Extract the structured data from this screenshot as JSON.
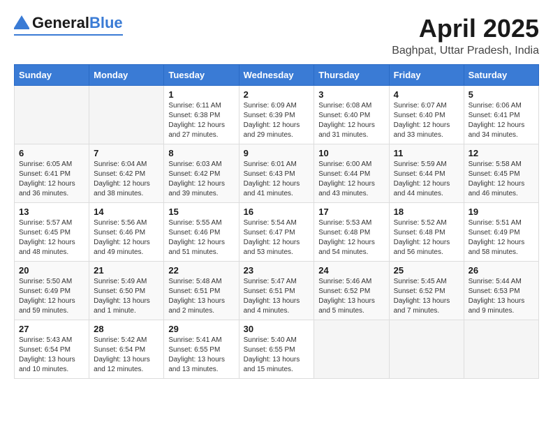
{
  "header": {
    "logo_general": "General",
    "logo_blue": "Blue",
    "month": "April 2025",
    "location": "Baghpat, Uttar Pradesh, India"
  },
  "days_of_week": [
    "Sunday",
    "Monday",
    "Tuesday",
    "Wednesday",
    "Thursday",
    "Friday",
    "Saturday"
  ],
  "weeks": [
    [
      {
        "day": "",
        "sunrise": "",
        "sunset": "",
        "daylight": ""
      },
      {
        "day": "",
        "sunrise": "",
        "sunset": "",
        "daylight": ""
      },
      {
        "day": "1",
        "sunrise": "Sunrise: 6:11 AM",
        "sunset": "Sunset: 6:38 PM",
        "daylight": "Daylight: 12 hours and 27 minutes."
      },
      {
        "day": "2",
        "sunrise": "Sunrise: 6:09 AM",
        "sunset": "Sunset: 6:39 PM",
        "daylight": "Daylight: 12 hours and 29 minutes."
      },
      {
        "day": "3",
        "sunrise": "Sunrise: 6:08 AM",
        "sunset": "Sunset: 6:40 PM",
        "daylight": "Daylight: 12 hours and 31 minutes."
      },
      {
        "day": "4",
        "sunrise": "Sunrise: 6:07 AM",
        "sunset": "Sunset: 6:40 PM",
        "daylight": "Daylight: 12 hours and 33 minutes."
      },
      {
        "day": "5",
        "sunrise": "Sunrise: 6:06 AM",
        "sunset": "Sunset: 6:41 PM",
        "daylight": "Daylight: 12 hours and 34 minutes."
      }
    ],
    [
      {
        "day": "6",
        "sunrise": "Sunrise: 6:05 AM",
        "sunset": "Sunset: 6:41 PM",
        "daylight": "Daylight: 12 hours and 36 minutes."
      },
      {
        "day": "7",
        "sunrise": "Sunrise: 6:04 AM",
        "sunset": "Sunset: 6:42 PM",
        "daylight": "Daylight: 12 hours and 38 minutes."
      },
      {
        "day": "8",
        "sunrise": "Sunrise: 6:03 AM",
        "sunset": "Sunset: 6:42 PM",
        "daylight": "Daylight: 12 hours and 39 minutes."
      },
      {
        "day": "9",
        "sunrise": "Sunrise: 6:01 AM",
        "sunset": "Sunset: 6:43 PM",
        "daylight": "Daylight: 12 hours and 41 minutes."
      },
      {
        "day": "10",
        "sunrise": "Sunrise: 6:00 AM",
        "sunset": "Sunset: 6:44 PM",
        "daylight": "Daylight: 12 hours and 43 minutes."
      },
      {
        "day": "11",
        "sunrise": "Sunrise: 5:59 AM",
        "sunset": "Sunset: 6:44 PM",
        "daylight": "Daylight: 12 hours and 44 minutes."
      },
      {
        "day": "12",
        "sunrise": "Sunrise: 5:58 AM",
        "sunset": "Sunset: 6:45 PM",
        "daylight": "Daylight: 12 hours and 46 minutes."
      }
    ],
    [
      {
        "day": "13",
        "sunrise": "Sunrise: 5:57 AM",
        "sunset": "Sunset: 6:45 PM",
        "daylight": "Daylight: 12 hours and 48 minutes."
      },
      {
        "day": "14",
        "sunrise": "Sunrise: 5:56 AM",
        "sunset": "Sunset: 6:46 PM",
        "daylight": "Daylight: 12 hours and 49 minutes."
      },
      {
        "day": "15",
        "sunrise": "Sunrise: 5:55 AM",
        "sunset": "Sunset: 6:46 PM",
        "daylight": "Daylight: 12 hours and 51 minutes."
      },
      {
        "day": "16",
        "sunrise": "Sunrise: 5:54 AM",
        "sunset": "Sunset: 6:47 PM",
        "daylight": "Daylight: 12 hours and 53 minutes."
      },
      {
        "day": "17",
        "sunrise": "Sunrise: 5:53 AM",
        "sunset": "Sunset: 6:48 PM",
        "daylight": "Daylight: 12 hours and 54 minutes."
      },
      {
        "day": "18",
        "sunrise": "Sunrise: 5:52 AM",
        "sunset": "Sunset: 6:48 PM",
        "daylight": "Daylight: 12 hours and 56 minutes."
      },
      {
        "day": "19",
        "sunrise": "Sunrise: 5:51 AM",
        "sunset": "Sunset: 6:49 PM",
        "daylight": "Daylight: 12 hours and 58 minutes."
      }
    ],
    [
      {
        "day": "20",
        "sunrise": "Sunrise: 5:50 AM",
        "sunset": "Sunset: 6:49 PM",
        "daylight": "Daylight: 12 hours and 59 minutes."
      },
      {
        "day": "21",
        "sunrise": "Sunrise: 5:49 AM",
        "sunset": "Sunset: 6:50 PM",
        "daylight": "Daylight: 13 hours and 1 minute."
      },
      {
        "day": "22",
        "sunrise": "Sunrise: 5:48 AM",
        "sunset": "Sunset: 6:51 PM",
        "daylight": "Daylight: 13 hours and 2 minutes."
      },
      {
        "day": "23",
        "sunrise": "Sunrise: 5:47 AM",
        "sunset": "Sunset: 6:51 PM",
        "daylight": "Daylight: 13 hours and 4 minutes."
      },
      {
        "day": "24",
        "sunrise": "Sunrise: 5:46 AM",
        "sunset": "Sunset: 6:52 PM",
        "daylight": "Daylight: 13 hours and 5 minutes."
      },
      {
        "day": "25",
        "sunrise": "Sunrise: 5:45 AM",
        "sunset": "Sunset: 6:52 PM",
        "daylight": "Daylight: 13 hours and 7 minutes."
      },
      {
        "day": "26",
        "sunrise": "Sunrise: 5:44 AM",
        "sunset": "Sunset: 6:53 PM",
        "daylight": "Daylight: 13 hours and 9 minutes."
      }
    ],
    [
      {
        "day": "27",
        "sunrise": "Sunrise: 5:43 AM",
        "sunset": "Sunset: 6:54 PM",
        "daylight": "Daylight: 13 hours and 10 minutes."
      },
      {
        "day": "28",
        "sunrise": "Sunrise: 5:42 AM",
        "sunset": "Sunset: 6:54 PM",
        "daylight": "Daylight: 13 hours and 12 minutes."
      },
      {
        "day": "29",
        "sunrise": "Sunrise: 5:41 AM",
        "sunset": "Sunset: 6:55 PM",
        "daylight": "Daylight: 13 hours and 13 minutes."
      },
      {
        "day": "30",
        "sunrise": "Sunrise: 5:40 AM",
        "sunset": "Sunset: 6:55 PM",
        "daylight": "Daylight: 13 hours and 15 minutes."
      },
      {
        "day": "",
        "sunrise": "",
        "sunset": "",
        "daylight": ""
      },
      {
        "day": "",
        "sunrise": "",
        "sunset": "",
        "daylight": ""
      },
      {
        "day": "",
        "sunrise": "",
        "sunset": "",
        "daylight": ""
      }
    ]
  ]
}
